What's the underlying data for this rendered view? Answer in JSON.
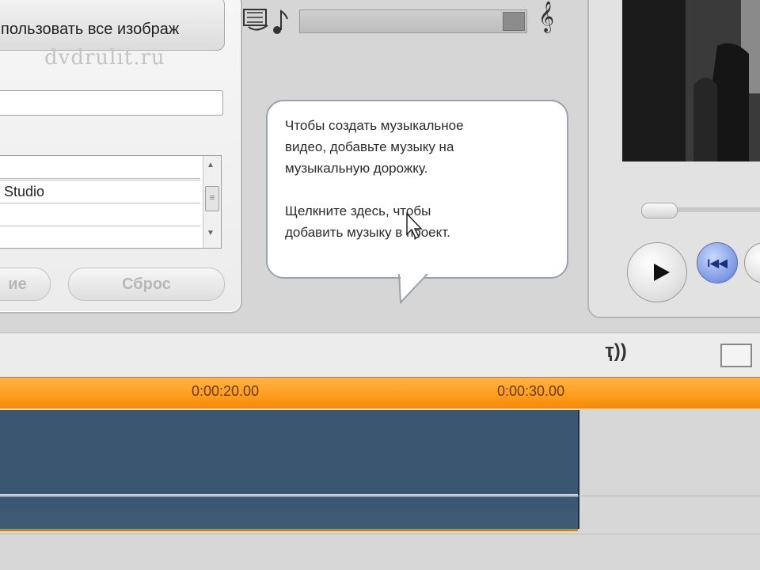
{
  "settings_panel": {
    "use_all_images_label": "пользовать все изображ",
    "watermark": "dvdrulit.ru",
    "title_field_value": "",
    "list_items": [
      "",
      "Studio",
      ""
    ],
    "buttons": {
      "left_partial_label": "ие",
      "reset_label": "Сброс"
    }
  },
  "audio": {
    "volume_level": 0.95,
    "clef_icon": "treble-clef-icon"
  },
  "callout": {
    "line1": "Чтобы создать музыкальное",
    "line2": "видео, добавьте музыку на",
    "line3": "музыкальную дорожку.",
    "line4": "Щелкните здесь, чтобы",
    "line5": "добавить музыку в проект."
  },
  "preview": {
    "play_icon": "play-icon",
    "rewind_icon": "rewind-icon",
    "rewind_glyph": "I◀◀"
  },
  "timeline": {
    "ticks": [
      "0:00:20.00",
      "0:00:30.00"
    ],
    "mic_glyph": "ҭ))",
    "colors": {
      "ruler": "#ff9c1a",
      "clip": "#3b5670"
    }
  }
}
